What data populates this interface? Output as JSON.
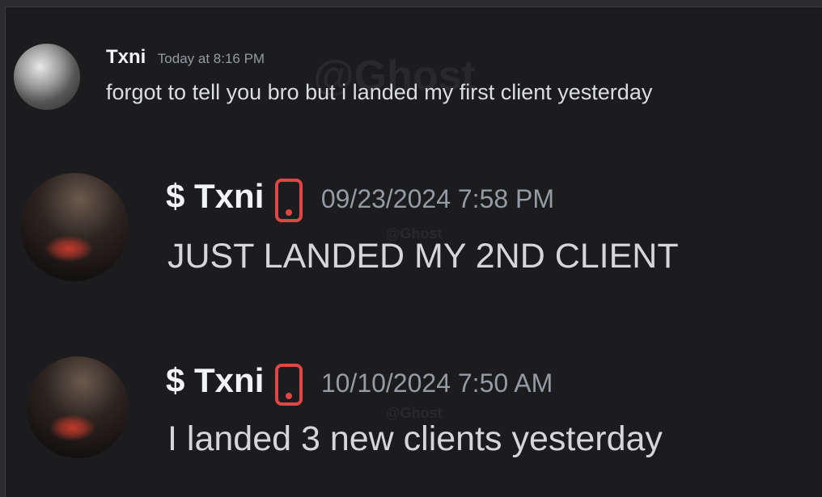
{
  "messages": [
    {
      "author": "Txni",
      "timestamp": "Today at 8:16 PM",
      "text": "forgot to tell you bro but i landed my first client yesterday",
      "avatar_icon": "user-avatar"
    },
    {
      "author": "$ Txni",
      "badge_icon": "mobile-phone-icon",
      "timestamp": "09/23/2024 7:58 PM",
      "text": "JUST LANDED MY 2ND CLIENT",
      "avatar_icon": "user-avatar"
    },
    {
      "author": "$ Txni",
      "badge_icon": "mobile-phone-icon",
      "timestamp": "10/10/2024 7:50 AM",
      "text": "I landed 3 new clients yesterday",
      "avatar_icon": "user-avatar"
    }
  ],
  "watermark": "@Ghost",
  "colors": {
    "background": "#1c1c1e",
    "username": "#f2f3f5",
    "timestamp": "#949ba4",
    "message_text": "#dbdee1",
    "phone_badge": "#e14545"
  }
}
